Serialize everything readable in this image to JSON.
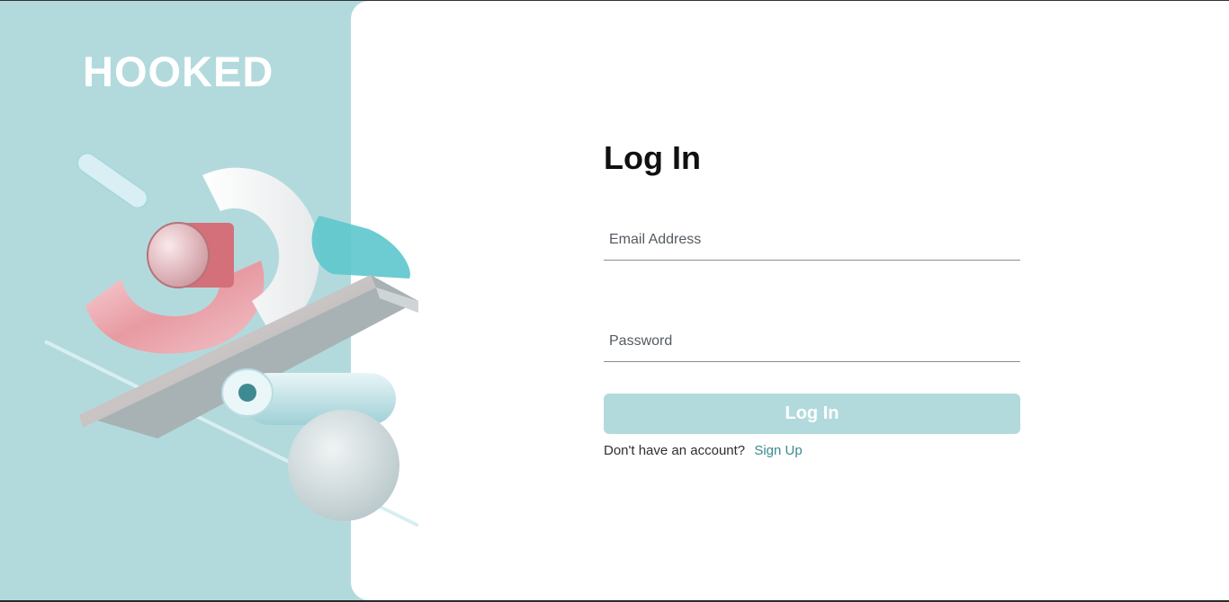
{
  "brand": {
    "name": "HOOKED"
  },
  "login_form": {
    "title": "Log In",
    "email_placeholder": "Email Address",
    "email_value": "",
    "password_placeholder": "Password",
    "password_value": "",
    "submit_label": "Log In",
    "signup_prompt": "Don't have an account?",
    "signup_link": "Sign Up"
  },
  "colors": {
    "accent": "#b2dadd",
    "link": "#3a8a8f",
    "background": "#ffffff"
  }
}
